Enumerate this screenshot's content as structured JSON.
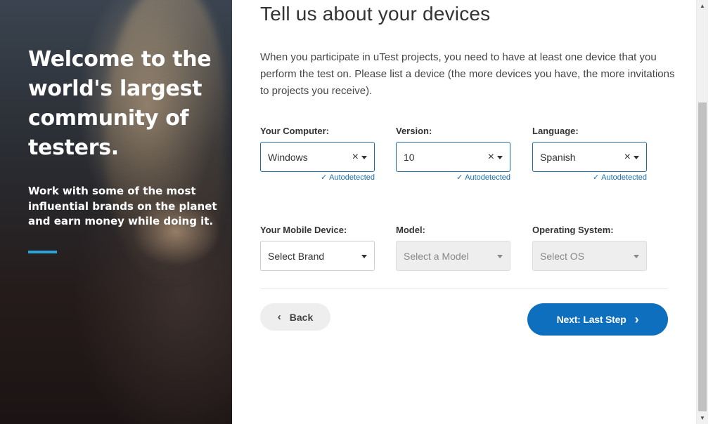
{
  "hero": {
    "title": "Welcome to the world's largest community of testers.",
    "subtitle": "Work with some of the most influential brands on the planet and earn money while doing it.",
    "accent_color": "#2aa3d9"
  },
  "form": {
    "heading": "Tell us about your devices",
    "intro": "When you participate in uTest projects, you need to have at least one device that you perform the test on. Please list a device (the more devices you have, the more invitations to projects you receive).",
    "computer": {
      "label": "Your Computer:",
      "value": "Windows",
      "autodetected": "Autodetected"
    },
    "version": {
      "label": "Version:",
      "value": "10",
      "autodetected": "Autodetected"
    },
    "language": {
      "label": "Language:",
      "value": "Spanish",
      "autodetected": "Autodetected"
    },
    "mobile_device": {
      "label": "Your Mobile Device:",
      "placeholder": "Select Brand"
    },
    "model": {
      "label": "Model:",
      "placeholder": "Select a Model"
    },
    "os": {
      "label": "Operating System:",
      "placeholder": "Select OS"
    },
    "back_label": "Back",
    "next_label": "Next: Last Step"
  },
  "icons": {
    "clear": "×",
    "check": "✓",
    "chevron_left": "‹",
    "chevron_right": "›",
    "scroll_up": "▲",
    "scroll_down": "▼"
  },
  "colors": {
    "primary": "#0d6fbd",
    "link": "#1b6ca8"
  }
}
